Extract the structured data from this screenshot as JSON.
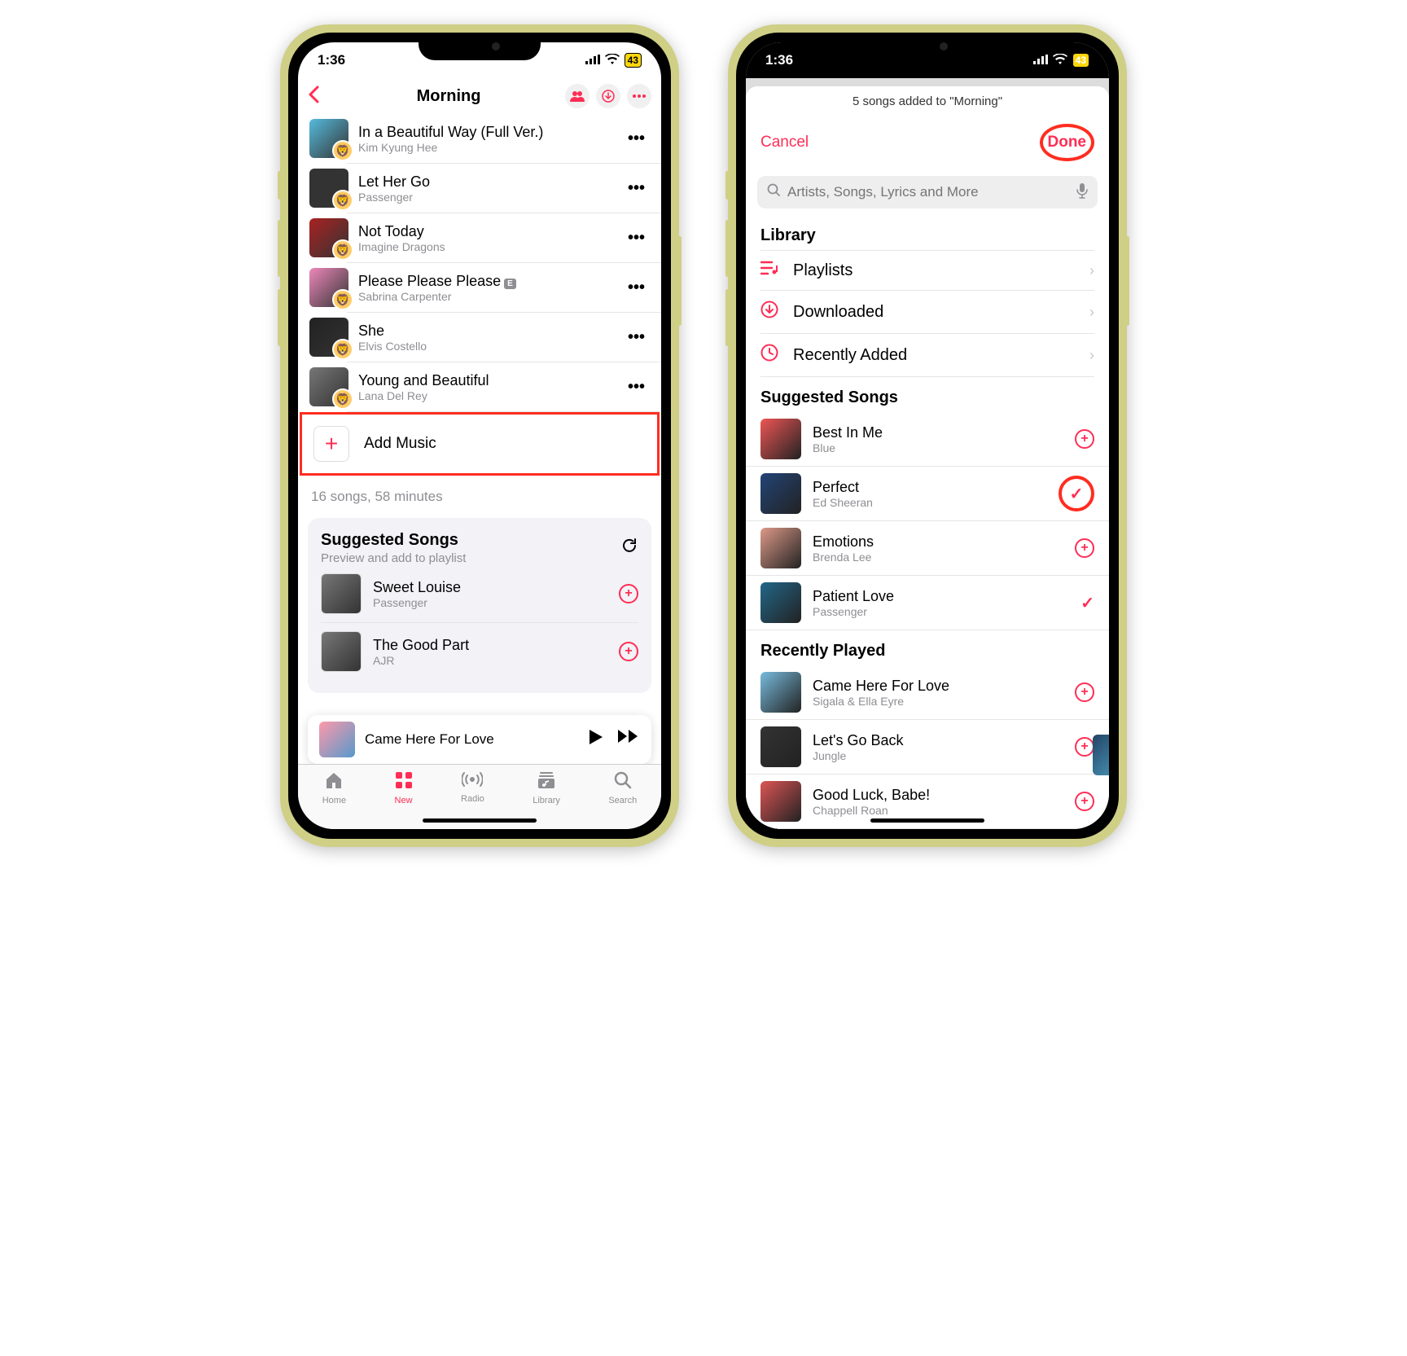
{
  "status": {
    "time": "1:36",
    "battery": "43"
  },
  "phone1": {
    "title": "Morning",
    "songs": [
      {
        "title": "In a Beautiful Way (Full Ver.)",
        "artist": "Kim Kyung Hee"
      },
      {
        "title": "Let Her Go",
        "artist": "Passenger"
      },
      {
        "title": "Not Today",
        "artist": "Imagine Dragons"
      },
      {
        "title": "Please Please Please",
        "artist": "Sabrina Carpenter",
        "explicit": "E"
      },
      {
        "title": "She",
        "artist": "Elvis Costello"
      },
      {
        "title": "Young and Beautiful",
        "artist": "Lana Del Rey"
      }
    ],
    "add_music": "Add Music",
    "stats": "16 songs, 58 minutes",
    "suggested": {
      "title": "Suggested Songs",
      "subtitle": "Preview and add to playlist",
      "items": [
        {
          "title": "Sweet Louise",
          "artist": "Passenger"
        },
        {
          "title": "The Good Part",
          "artist": "AJR"
        }
      ]
    },
    "now_playing": "Came Here For Love",
    "tabs": [
      {
        "label": "Home"
      },
      {
        "label": "New"
      },
      {
        "label": "Radio"
      },
      {
        "label": "Library"
      },
      {
        "label": "Search"
      }
    ]
  },
  "phone2": {
    "status_msg": "5 songs added to \"Morning\"",
    "cancel": "Cancel",
    "done": "Done",
    "search_placeholder": "Artists, Songs, Lyrics and More",
    "library_hdr": "Library",
    "library": [
      {
        "label": "Playlists"
      },
      {
        "label": "Downloaded"
      },
      {
        "label": "Recently Added"
      }
    ],
    "suggested_hdr": "Suggested Songs",
    "suggested": [
      {
        "title": "Best In Me",
        "artist": "Blue",
        "state": "add"
      },
      {
        "title": "Perfect",
        "artist": "Ed Sheeran",
        "state": "check-circled"
      },
      {
        "title": "Emotions",
        "artist": "Brenda Lee",
        "state": "add"
      },
      {
        "title": "Patient Love",
        "artist": "Passenger",
        "state": "check"
      }
    ],
    "recent_hdr": "Recently Played",
    "recent": [
      {
        "title": "Came Here For Love",
        "artist": "Sigala & Ella Eyre",
        "state": "add"
      },
      {
        "title": "Let's Go Back",
        "artist": "Jungle",
        "state": "add"
      },
      {
        "title": "Good Luck, Babe!",
        "artist": "Chappell Roan",
        "state": "add"
      }
    ]
  }
}
